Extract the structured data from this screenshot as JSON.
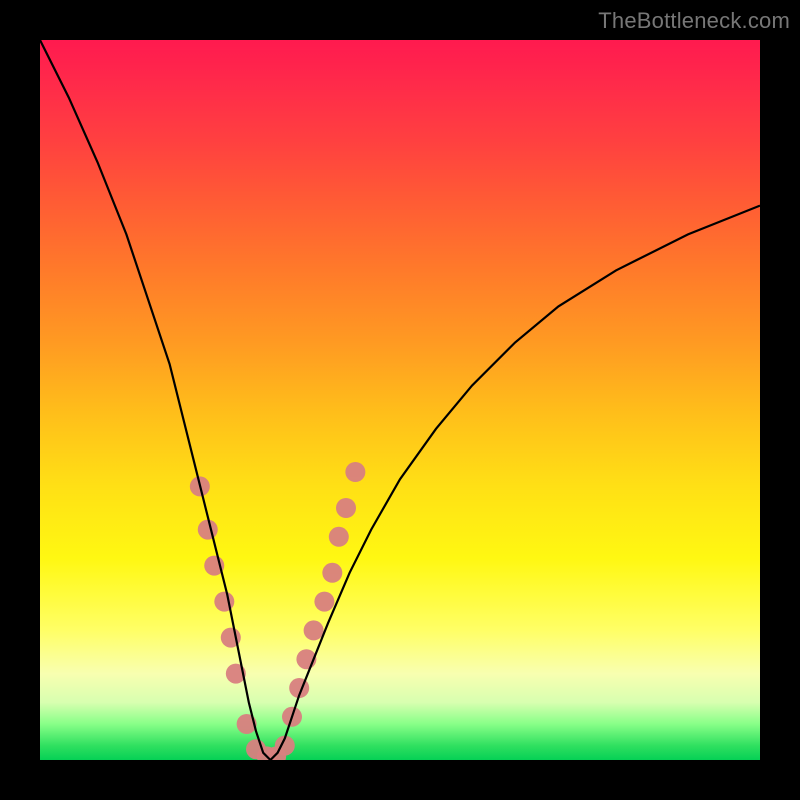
{
  "watermark": {
    "text": "TheBottleneck.com"
  },
  "chart_data": {
    "type": "line",
    "title": "",
    "xlabel": "",
    "ylabel": "",
    "xlim": [
      0,
      100
    ],
    "ylim": [
      0,
      100
    ],
    "grid": false,
    "legend": null,
    "gradient_stops": [
      {
        "pct": 0,
        "color": "#ff1a4f"
      },
      {
        "pct": 25,
        "color": "#ff6a30"
      },
      {
        "pct": 50,
        "color": "#ffc818"
      },
      {
        "pct": 75,
        "color": "#fff812"
      },
      {
        "pct": 90,
        "color": "#eaff80"
      },
      {
        "pct": 100,
        "color": "#05d055"
      }
    ],
    "series": [
      {
        "name": "bottleneck-curve",
        "color": "#000000",
        "x": [
          0,
          4,
          8,
          12,
          15,
          18,
          20,
          22,
          24,
          26,
          27,
          28,
          29,
          30,
          31,
          32,
          33,
          34,
          35,
          36,
          38,
          40,
          43,
          46,
          50,
          55,
          60,
          66,
          72,
          80,
          90,
          100
        ],
        "y": [
          100,
          92,
          83,
          73,
          64,
          55,
          47,
          39,
          31,
          23,
          18,
          13,
          8,
          4,
          1,
          0,
          1,
          3,
          6,
          9,
          14,
          19,
          26,
          32,
          39,
          46,
          52,
          58,
          63,
          68,
          73,
          77
        ]
      }
    ],
    "markers": {
      "name": "highlight-dots",
      "color": "#d88080",
      "radius": 10,
      "points": [
        {
          "x": 22.2,
          "y": 38
        },
        {
          "x": 23.3,
          "y": 32
        },
        {
          "x": 24.2,
          "y": 27
        },
        {
          "x": 25.6,
          "y": 22
        },
        {
          "x": 26.5,
          "y": 17
        },
        {
          "x": 27.2,
          "y": 12
        },
        {
          "x": 28.7,
          "y": 5
        },
        {
          "x": 30.0,
          "y": 1.5
        },
        {
          "x": 31.5,
          "y": 0.5
        },
        {
          "x": 32.8,
          "y": 0.5
        },
        {
          "x": 34.0,
          "y": 2
        },
        {
          "x": 35.0,
          "y": 6
        },
        {
          "x": 36.0,
          "y": 10
        },
        {
          "x": 37.0,
          "y": 14
        },
        {
          "x": 38.0,
          "y": 18
        },
        {
          "x": 39.5,
          "y": 22
        },
        {
          "x": 40.6,
          "y": 26
        },
        {
          "x": 41.5,
          "y": 31
        },
        {
          "x": 42.5,
          "y": 35
        },
        {
          "x": 43.8,
          "y": 40
        }
      ]
    }
  }
}
